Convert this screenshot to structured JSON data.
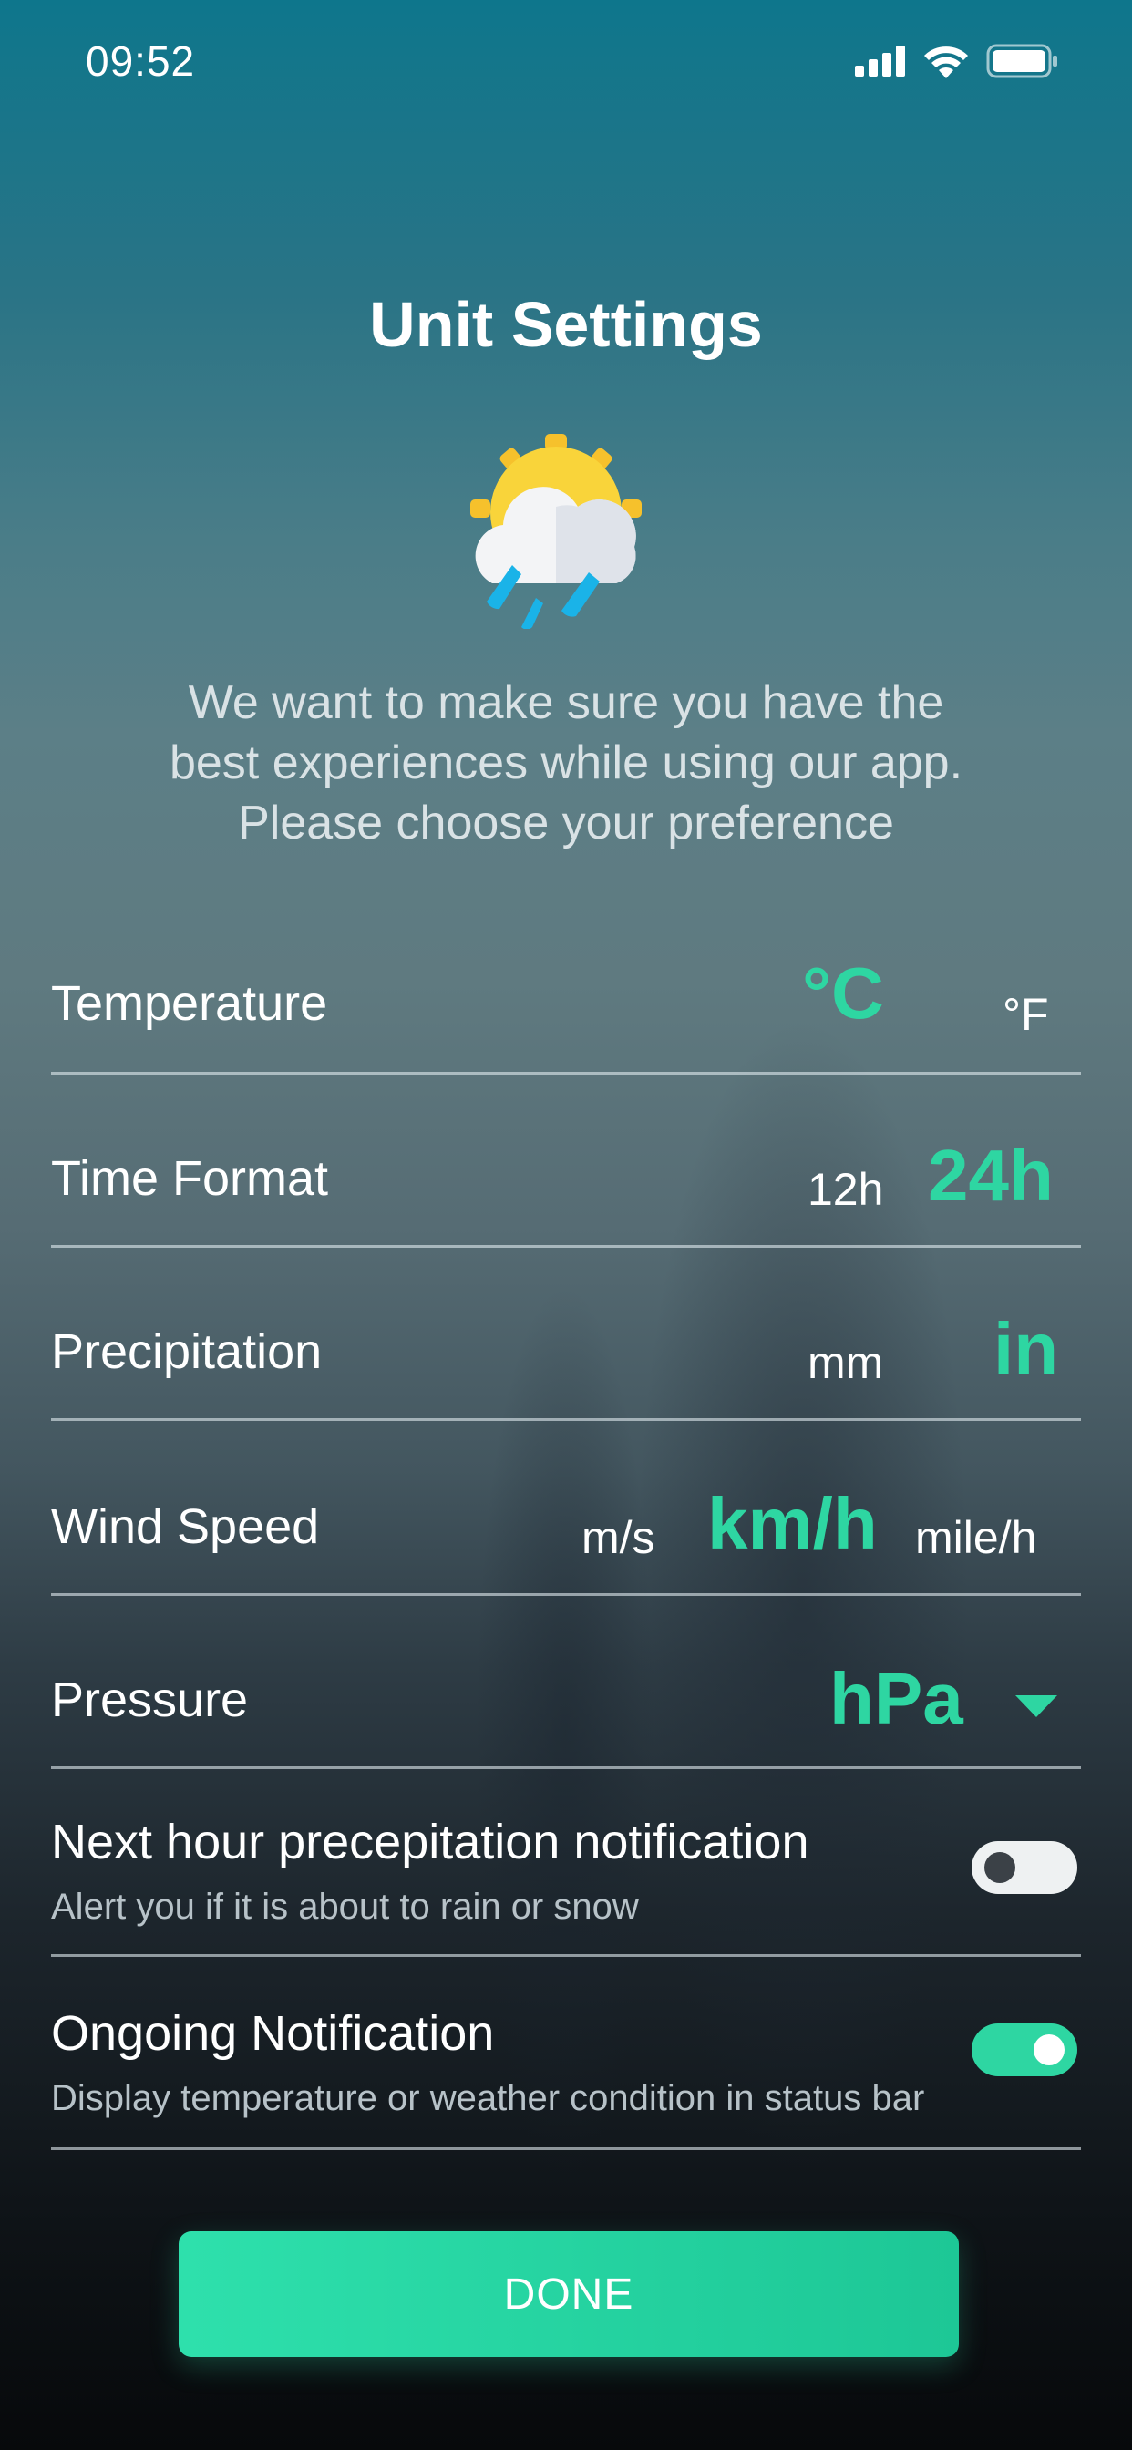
{
  "status_bar": {
    "time": "09:52",
    "icons": [
      "cellular-signal-icon",
      "wifi-icon",
      "battery-icon"
    ]
  },
  "header": {
    "title": "Unit Settings",
    "icon": "sun-cloud-rain-icon"
  },
  "intro": {
    "line1": "We want to make sure you have the",
    "line2": "best experiences while using our app.",
    "line3": "Please choose your preference"
  },
  "settings": {
    "temperature": {
      "label": "Temperature",
      "options": [
        "°C",
        "°F"
      ],
      "selected": "°C"
    },
    "time_format": {
      "label": "Time Format",
      "options": [
        "12h",
        "24h"
      ],
      "selected": "24h"
    },
    "precipitation": {
      "label": "Precipitation",
      "options": [
        "mm",
        "in"
      ],
      "selected": "in"
    },
    "wind_speed": {
      "label": "Wind Speed",
      "options": [
        "m/s",
        "km/h",
        "mile/h"
      ],
      "selected": "km/h"
    },
    "pressure": {
      "label": "Pressure",
      "selected": "hPa"
    }
  },
  "notifications": {
    "next_hour": {
      "title": "Next hour precepitation notification",
      "subtitle": "Alert you if it is about to rain or snow",
      "enabled": false
    },
    "ongoing": {
      "title": "Ongoing Notification",
      "subtitle": "Display temperature or weather condition in status bar",
      "enabled": true
    }
  },
  "done_label": "DONE",
  "colors": {
    "accent": "#2ed6a2",
    "text": "#ffffff",
    "muted": "#b7c2c8"
  }
}
